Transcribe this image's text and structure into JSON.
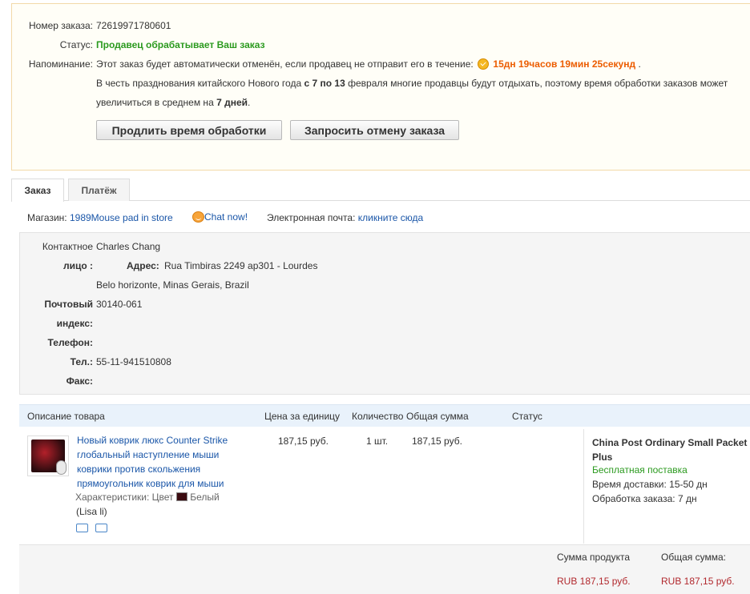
{
  "order": {
    "number_label": "Номер заказа:",
    "number": "72619971780601",
    "status_label": "Статус:",
    "status": "Продавец обрабатывает Ваш заказ",
    "reminder_label": "Напоминание:",
    "reminder_text": "Этот заказ будет автоматически отменён, если продавец не отправит его в течение:",
    "timer": "15дн 19часов 19мин 25секунд",
    "timer_suffix": ".",
    "notice_part1": "В честь празднования китайского Нового года",
    "notice_bold1": "с 7 по 13",
    "notice_part2": "февраля многие продавцы будут отдыхать, поэтому время обработки заказов может",
    "notice_part3": "увеличиться в среднем на",
    "notice_bold2": "7 дней",
    "notice_end": ".",
    "extend_button": "Продлить время обработки",
    "cancel_button": "Запросить отмену заказа"
  },
  "tabs": [
    {
      "label": "Заказ",
      "active": true
    },
    {
      "label": "Платёж",
      "active": false
    }
  ],
  "store": {
    "label": "Магазин:",
    "name": "1989Mouse pad in store",
    "chat": "Chat now!",
    "email_label": "Электронная почта:",
    "email_link": "кликните сюда"
  },
  "address": {
    "contact_label_1": "Контактное",
    "contact_label_2": "лицо :",
    "contact": "Charles Chang",
    "addr_label": "Адрес:",
    "addr_line1": "Rua Timbiras 2249 ap301 - Lourdes",
    "addr_line2": "Belo horizonte, Minas Gerais, Brazil",
    "zip_label_1": "Почтовый",
    "zip_label_2": "индекс:",
    "zip": "30140-061",
    "phone_label": "Телефон:",
    "phone": "",
    "tel_label": "Тел.:",
    "tel": "55-11-941510808",
    "fax_label": "Факс:",
    "fax": ""
  },
  "table": {
    "headers": [
      "Описание товара",
      "Цена за единицу",
      "Количество",
      "Общая сумма",
      "Статус"
    ],
    "product": {
      "title_lines": [
        "Новый коврик люкс Counter Strike",
        "глобальный наступление мыши",
        "коврики против скольжения",
        "прямоугольник коврик для мыши"
      ],
      "attr_label": "Характеристики: Цвет",
      "attr_value": "Белый",
      "seller": "(Lisa li)",
      "unit_price": "187,15 руб.",
      "quantity": "1 шт.",
      "total": "187,15 руб.",
      "status": ""
    },
    "shipping": {
      "method": "China Post Ordinary Small Packet Plus",
      "free": "Бесплатная поставка",
      "delivery_label": "Время доставки:",
      "delivery": "15-50 дн",
      "processing_label": "Обработка заказа:",
      "processing": "7 дн"
    }
  },
  "summary": {
    "product_sum_label": "Сумма продукта",
    "product_sum": "RUB 187,15 руб.",
    "total_label": "Общая сумма:",
    "total": "RUB 187,15 руб."
  }
}
